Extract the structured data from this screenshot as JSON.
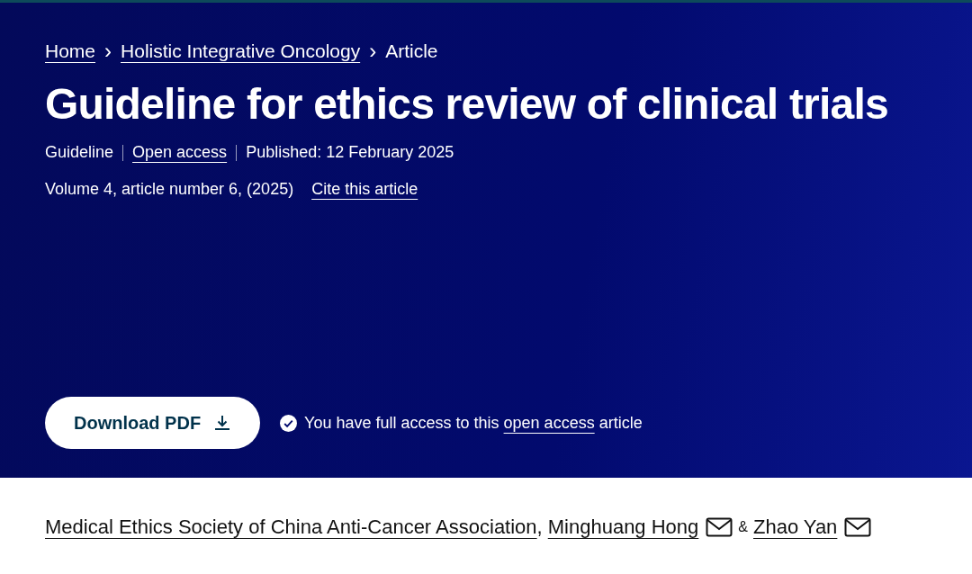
{
  "breadcrumb": [
    {
      "label": "Home",
      "link": true
    },
    {
      "label": "Holistic Integrative Oncology",
      "link": true
    },
    {
      "label": "Article",
      "link": false
    }
  ],
  "separator": "›",
  "title": "Guideline for ethics review of clinical trials",
  "meta": [
    {
      "kind": "text",
      "text": "Guideline"
    },
    {
      "kind": "link",
      "text": "Open access"
    },
    {
      "kind": "text",
      "text": "Published: 12 February 2025"
    }
  ],
  "citation": {
    "text": "Volume 4, article number 6, (2025)",
    "link": "Cite this article"
  },
  "download_button": "Download PDF",
  "access": {
    "before": "You have full access to this",
    "link": "open access",
    "after": "article"
  },
  "authors": [
    {
      "name": "Medical Ethics Society of China Anti-Cancer Association",
      "email": false,
      "separator": ","
    },
    {
      "name": "Minghuang Hong",
      "email": true,
      "separator": "&"
    },
    {
      "name": "Zhao Yan",
      "email": true
    }
  ]
}
